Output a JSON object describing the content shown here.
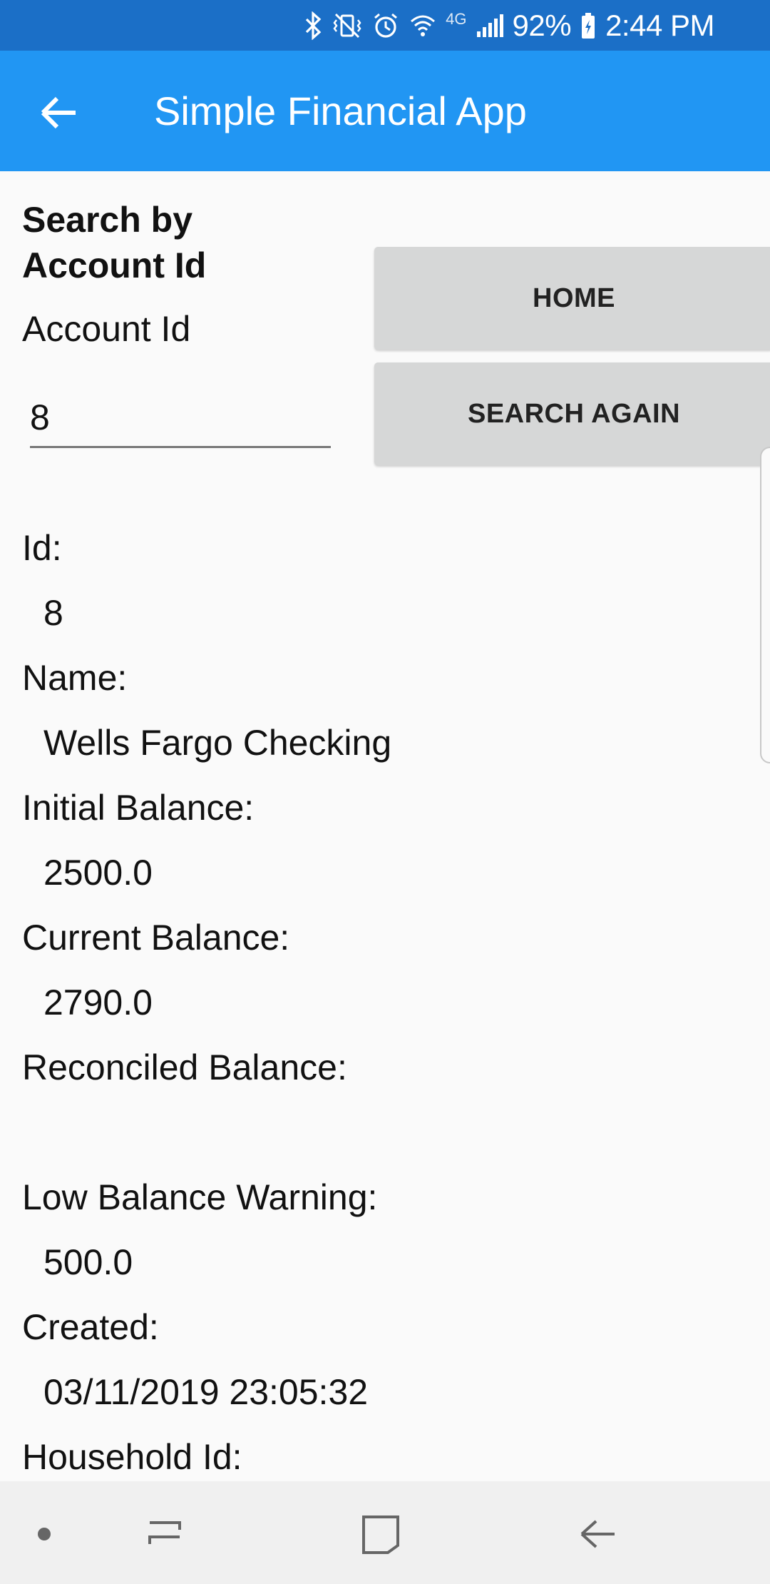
{
  "status_bar": {
    "battery": "92%",
    "time": "2:44 PM",
    "network": "4G",
    "icons": [
      "bluetooth-icon",
      "vibrate-mute-icon",
      "alarm-icon",
      "wifi-icon",
      "network-4g-icon",
      "signal-icon",
      "battery-icon"
    ]
  },
  "app_bar": {
    "title": "Simple Financial App",
    "back_icon": "back-arrow-icon",
    "color": "#2196f3"
  },
  "search": {
    "heading": "Search by Account Id",
    "field_label": "Account Id",
    "value": "8",
    "home_button": "HOME",
    "search_again_button": "SEARCH AGAIN"
  },
  "account": {
    "id_label": "Id:",
    "id_value": "8",
    "name_label": "Name:",
    "name_value": "Wells Fargo Checking",
    "initial_balance_label": "Initial Balance:",
    "initial_balance_value": "2500.0",
    "current_balance_label": "Current Balance:",
    "current_balance_value": "2790.0",
    "reconciled_balance_label": "Reconciled Balance:",
    "reconciled_balance_value": "",
    "low_balance_label": "Low Balance Warning:",
    "low_balance_value": "500.0",
    "created_label": "Created:",
    "created_value": "03/11/2019 23:05:32",
    "household_label": "Household Id:"
  },
  "nav_bar": {
    "items": [
      "dot-icon",
      "recent-apps-icon",
      "home-square-icon",
      "back-icon"
    ]
  }
}
